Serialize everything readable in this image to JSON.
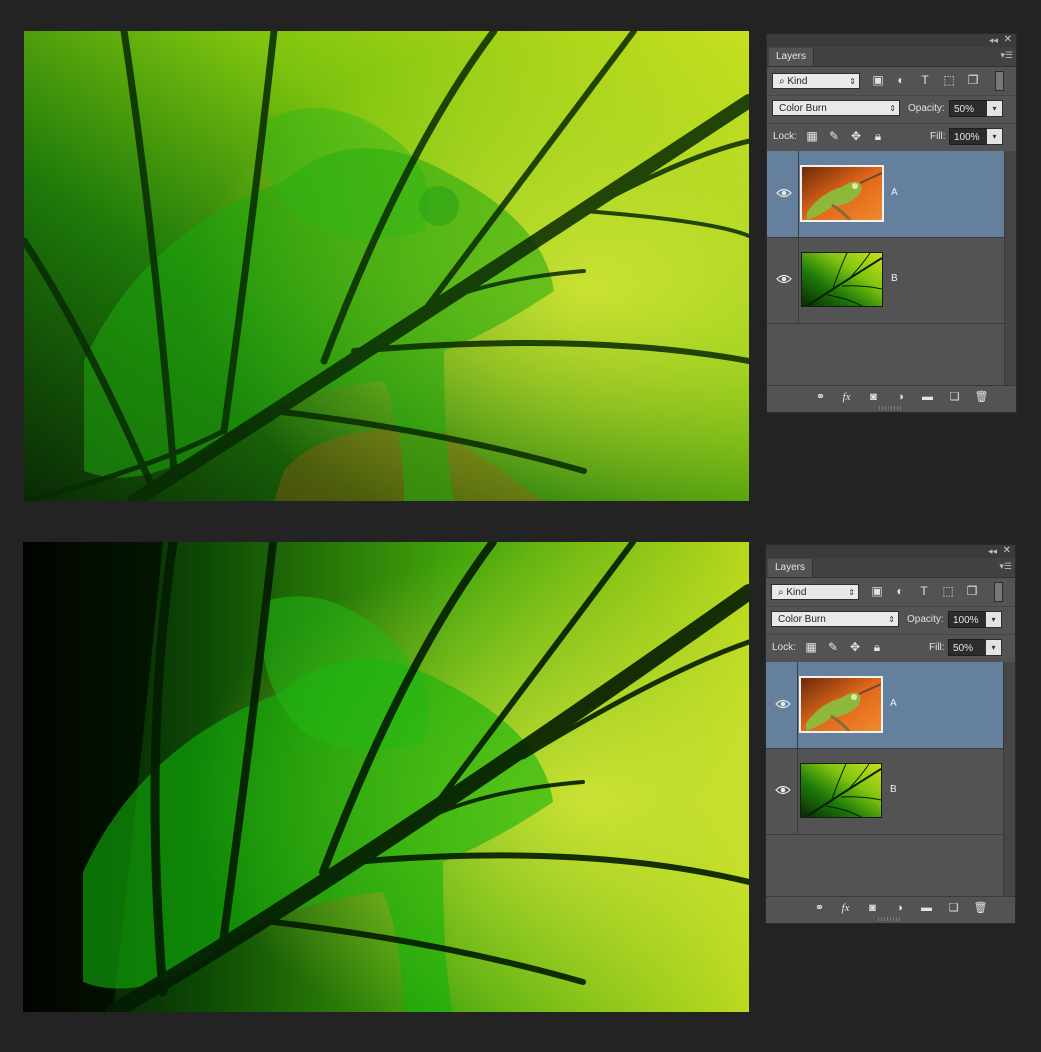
{
  "colors": {
    "app_background": "#232323",
    "panel": "#535353",
    "selected_layer": "#64809d"
  },
  "panels": [
    {
      "title": "Layers",
      "filter_kind": "Kind",
      "blend_mode": "Color Burn",
      "opacity_label": "Opacity:",
      "opacity_value": "50%",
      "lock_label": "Lock:",
      "fill_label": "Fill:",
      "fill_value": "100%",
      "layers": [
        {
          "name": "A",
          "selected": true,
          "visible": true,
          "thumbnail": "chameleon"
        },
        {
          "name": "B",
          "selected": false,
          "visible": true,
          "thumbnail": "leaf"
        }
      ]
    },
    {
      "title": "Layers",
      "filter_kind": "Kind",
      "blend_mode": "Color Burn",
      "opacity_label": "Opacity:",
      "opacity_value": "100%",
      "lock_label": "Lock:",
      "fill_label": "Fill:",
      "fill_value": "50%",
      "layers": [
        {
          "name": "A",
          "selected": true,
          "visible": true,
          "thumbnail": "chameleon"
        },
        {
          "name": "B",
          "selected": false,
          "visible": true,
          "thumbnail": "leaf"
        }
      ]
    }
  ],
  "icons": {
    "filter_icons": [
      "image-filter-icon",
      "adjustment-filter-icon",
      "type-filter-icon",
      "shape-filter-icon",
      "smart-object-filter-icon"
    ],
    "lock_icons": [
      "lock-transparent-pixels-icon",
      "lock-image-pixels-icon",
      "lock-position-icon",
      "lock-all-icon"
    ],
    "footer_icons": [
      "link-layers-icon",
      "fx-icon",
      "add-mask-icon",
      "new-adjustment-layer-icon",
      "new-group-icon",
      "new-layer-icon",
      "delete-layer-icon"
    ]
  }
}
